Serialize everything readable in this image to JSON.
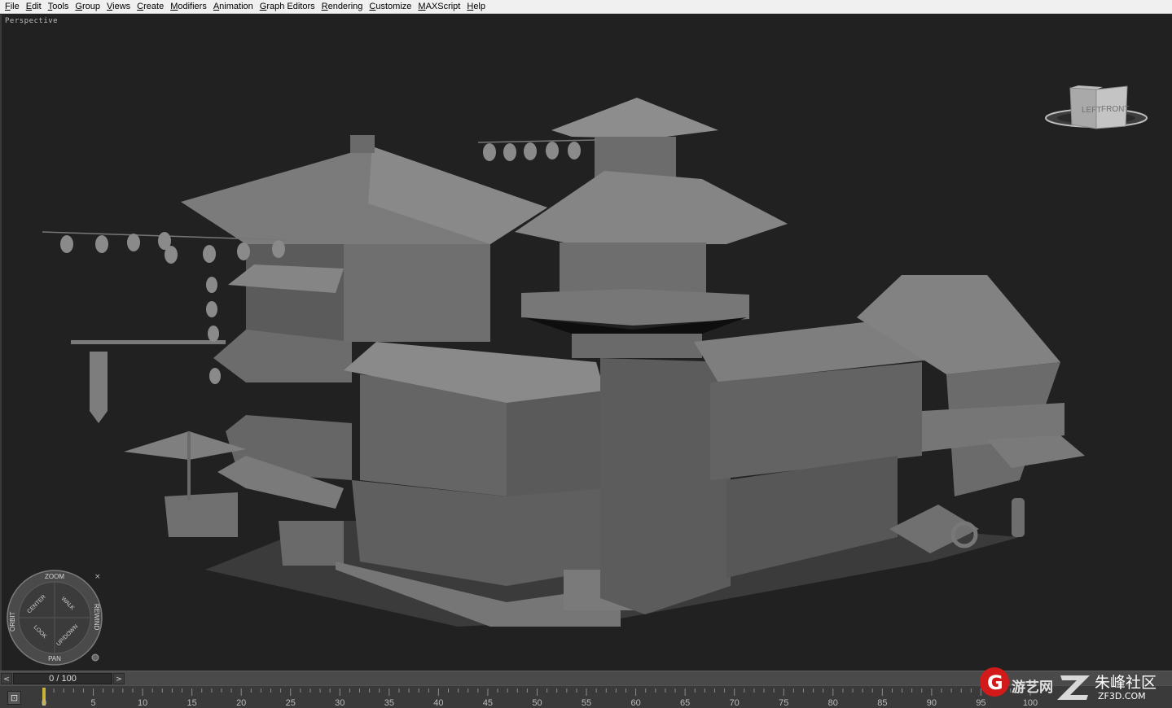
{
  "menu": {
    "items": [
      "File",
      "Edit",
      "Tools",
      "Group",
      "Views",
      "Create",
      "Modifiers",
      "Animation",
      "Graph Editors",
      "Rendering",
      "Customize",
      "MAXScript",
      "Help"
    ]
  },
  "viewport": {
    "label": "Perspective"
  },
  "viewcube": {
    "left_face": "LEFT",
    "front_face": "FRONT"
  },
  "steering_wheel": {
    "zoom": "ZOOM",
    "orbit": "ORBIT",
    "center": "CENTER",
    "walk": "WALK",
    "rewind": "REWIND",
    "look": "LOOK",
    "updown": "UP/DOWN",
    "pan": "PAN",
    "close_glyph": "×"
  },
  "time_slider": {
    "value": "0 / 100",
    "prev_glyph": "<",
    "next_glyph": ">"
  },
  "track_bar": {
    "key_icon_glyph": "⊡",
    "ticks": [
      "0",
      "5",
      "10",
      "15",
      "20",
      "25",
      "30",
      "35",
      "40",
      "45",
      "50",
      "55",
      "60",
      "65",
      "70",
      "75",
      "80",
      "85",
      "90",
      "95",
      "100"
    ]
  },
  "watermark": {
    "brand_cn": "游艺网",
    "community_cn": "朱峰社区",
    "domain": "ZF3D.COM",
    "logo_letter": "G"
  }
}
